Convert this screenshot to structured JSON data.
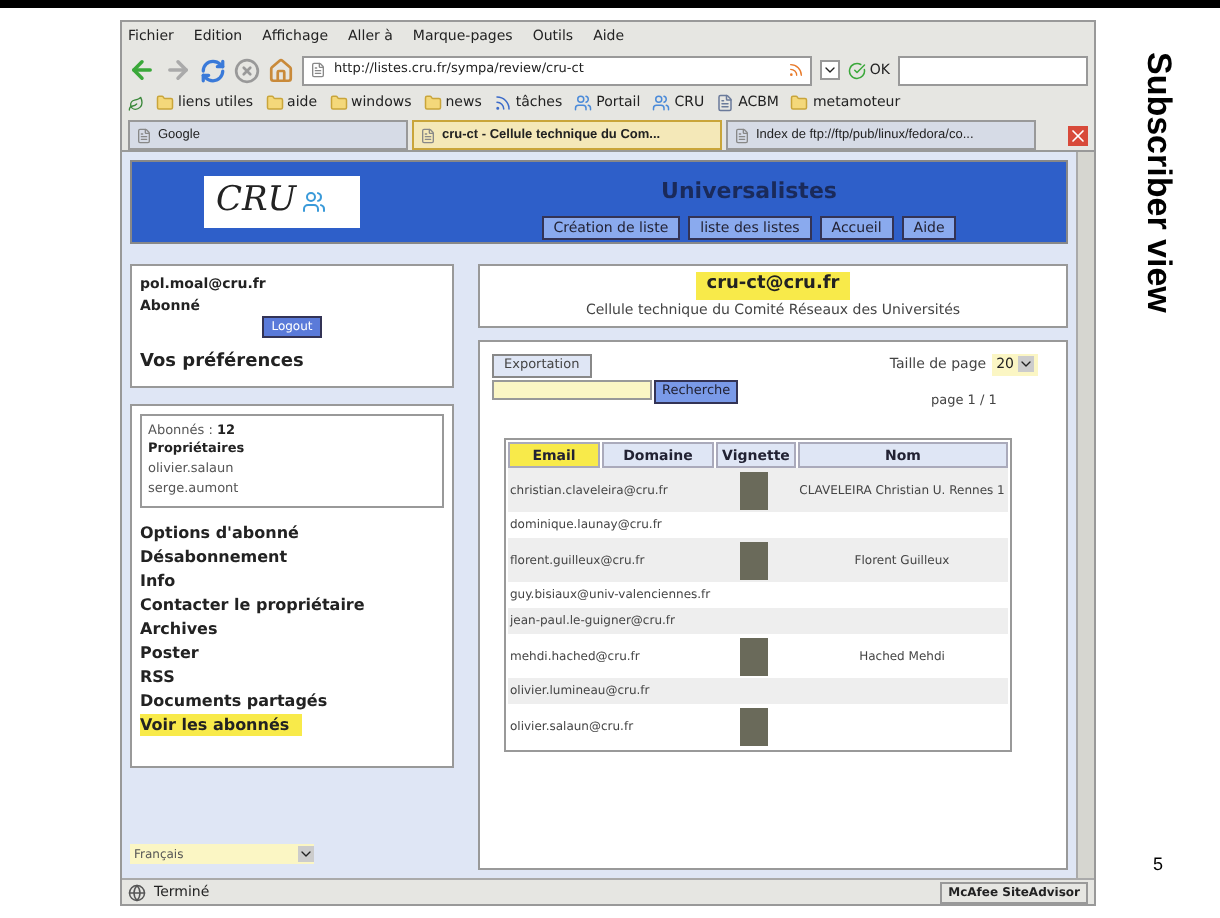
{
  "menu": [
    "Fichier",
    "Edition",
    "Affichage",
    "Aller à",
    "Marque-pages",
    "Outils",
    "Aide"
  ],
  "address": "http://listes.cru.fr/sympa/review/cru-ct",
  "go_button": "OK",
  "bookmarks": [
    {
      "label": "liens utiles",
      "kind": "folder"
    },
    {
      "label": "aide",
      "kind": "folder"
    },
    {
      "label": "windows",
      "kind": "folder"
    },
    {
      "label": "news",
      "kind": "folder"
    },
    {
      "label": "tâches",
      "kind": "feed"
    },
    {
      "label": "Portail",
      "kind": "site"
    },
    {
      "label": "CRU",
      "kind": "site"
    },
    {
      "label": "ACBM",
      "kind": "page"
    },
    {
      "label": "metamoteur",
      "kind": "folder"
    }
  ],
  "tabs": [
    {
      "label": "Google",
      "selected": false
    },
    {
      "label": "cru-ct - Cellule technique du Com...",
      "selected": true
    },
    {
      "label": "Index de ftp://ftp/pub/linux/fedora/co...",
      "selected": false
    }
  ],
  "site": {
    "logo": "CRU",
    "title": "Universalistes",
    "nav": [
      "Création de liste",
      "liste des listes",
      "Accueil",
      "Aide"
    ]
  },
  "user": {
    "email": "pol.moal@cru.fr",
    "role": "Abonné",
    "logout": "Logout",
    "preferences": "Vos préférences"
  },
  "list_info": {
    "subscribers_label": "Abonnés :",
    "subscribers_count": "12",
    "owners_title": "Propriétaires",
    "owners": [
      "olivier.salaun",
      "serge.aumont"
    ]
  },
  "list_menu": [
    {
      "label": "Options d'abonné",
      "selected": false
    },
    {
      "label": "Désabonnement",
      "selected": false
    },
    {
      "label": "Info",
      "selected": false
    },
    {
      "label": "Contacter le propriétaire",
      "selected": false
    },
    {
      "label": "Archives",
      "selected": false
    },
    {
      "label": "Poster",
      "selected": false
    },
    {
      "label": "RSS",
      "selected": false
    },
    {
      "label": "Documents partagés",
      "selected": false
    },
    {
      "label": "Voir les abonnés",
      "selected": true
    }
  ],
  "language": "Français",
  "list_header": {
    "address": "cru-ct@cru.fr",
    "description": "Cellule technique du Comité Réseaux des Universités"
  },
  "export_button": "Exportation",
  "search_button": "Recherche",
  "page_size_label": "Taille de page",
  "page_size": "20",
  "page_indicator": "page 1 / 1",
  "table": {
    "columns": [
      {
        "label": "Email",
        "selected": true
      },
      {
        "label": "Domaine",
        "selected": false
      },
      {
        "label": "Vignette",
        "selected": false
      },
      {
        "label": "Nom",
        "selected": false
      }
    ],
    "rows": [
      {
        "email": "christian.claveleira@cru.fr",
        "photo": true,
        "name": "CLAVELEIRA Christian U. Rennes 1"
      },
      {
        "email": "dominique.launay@cru.fr",
        "photo": false
      },
      {
        "email": "florent.guilleux@cru.fr",
        "photo": true,
        "name": "Florent Guilleux"
      },
      {
        "email": "guy.bisiaux@univ-valenciennes.fr",
        "photo": false
      },
      {
        "email": "jean-paul.le-guigner@cru.fr",
        "photo": false
      },
      {
        "email": "mehdi.hached@cru.fr",
        "photo": true,
        "name": "Hached Mehdi"
      },
      {
        "email": "olivier.lumineau@cru.fr",
        "photo": false
      },
      {
        "email": "olivier.salaun@cru.fr",
        "photo": true
      }
    ]
  },
  "status_bar": {
    "text": "Terminé",
    "addon": "McAfee SiteAdvisor"
  },
  "slide": {
    "title": "Subscriber view",
    "page_number": "5"
  }
}
